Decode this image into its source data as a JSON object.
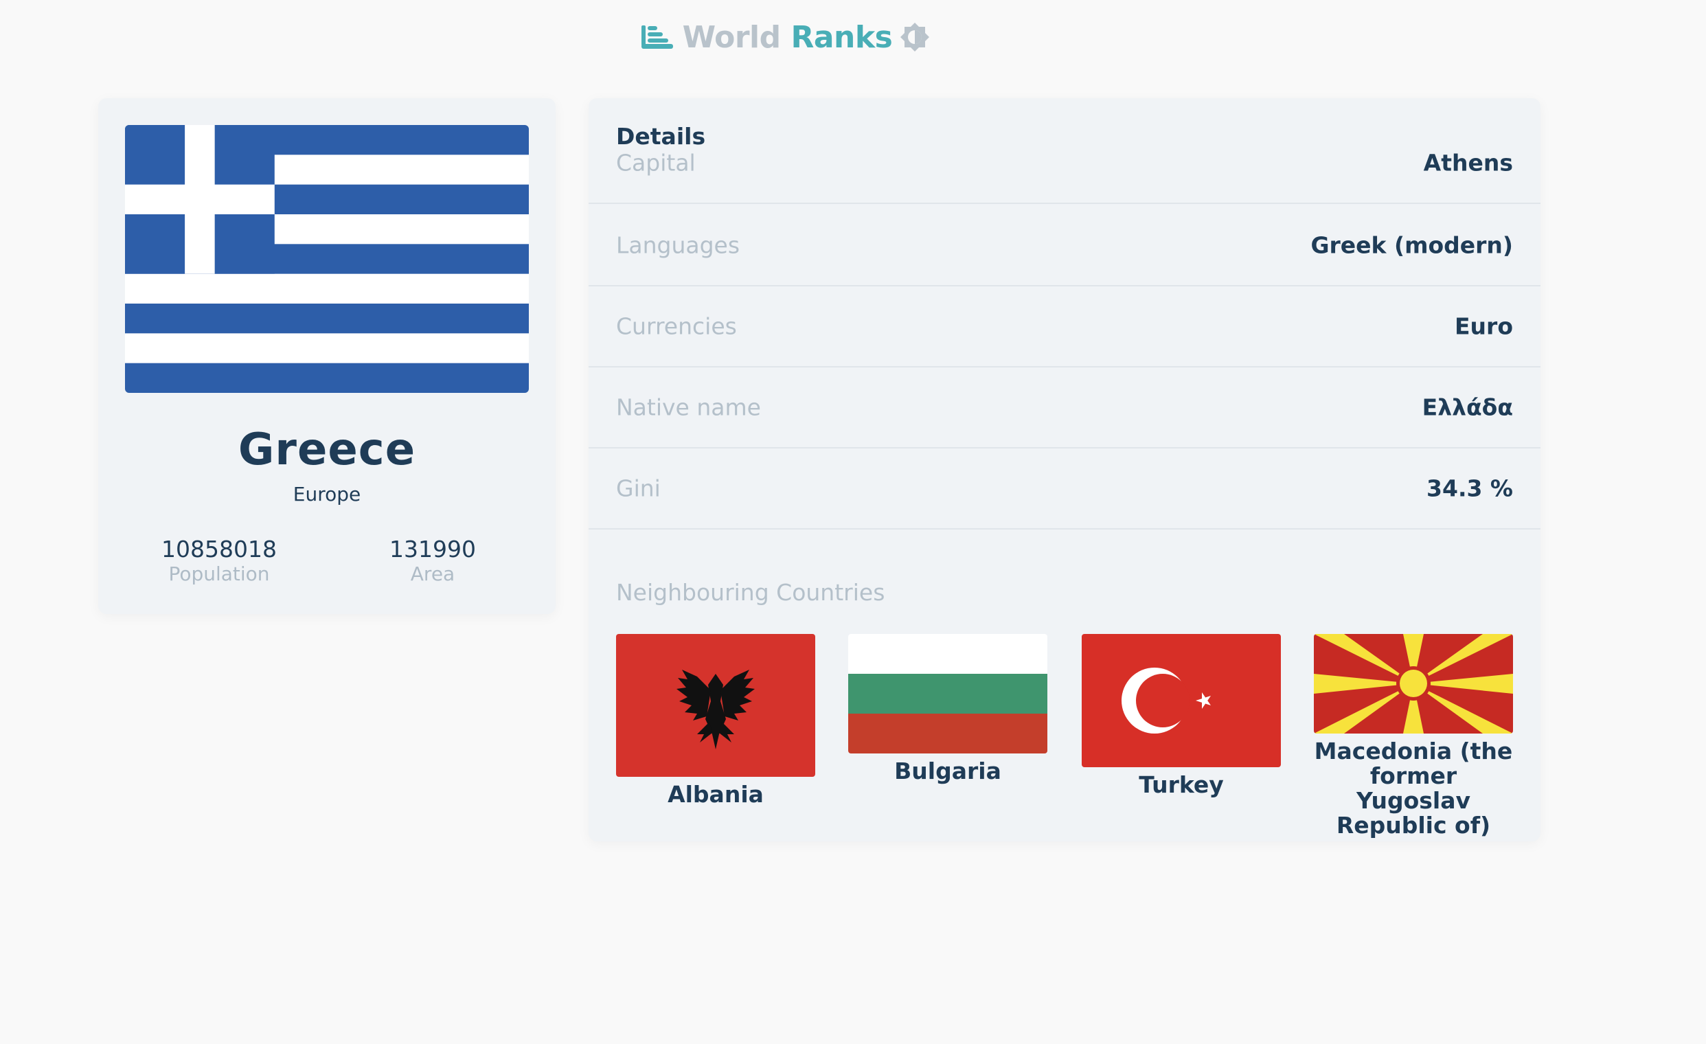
{
  "header": {
    "title_part1": "World",
    "title_part2": "Ranks",
    "logo_icon": "bars-chart-icon",
    "theme_icon": "brightness-icon",
    "colors": {
      "world": "#b9c3cb",
      "ranks": "#49aeb6"
    }
  },
  "country": {
    "name": "Greece",
    "region": "Europe",
    "population_value": "10858018",
    "population_label": "Population",
    "area_value": "131990",
    "area_label": "Area",
    "flag_colors": {
      "blue": "#2d5ea9",
      "white": "#ffffff"
    }
  },
  "details": {
    "title": "Details",
    "rows": [
      {
        "label": "Capital",
        "value": "Athens"
      },
      {
        "label": "Languages",
        "value": "Greek (modern)"
      },
      {
        "label": "Currencies",
        "value": "Euro"
      },
      {
        "label": "Native name",
        "value": "Ελλάδα"
      },
      {
        "label": "Gini",
        "value": "34.3 %"
      }
    ],
    "neighbours_title": "Neighbouring Countries",
    "neighbours": [
      {
        "name": "Albania"
      },
      {
        "name": "Bulgaria"
      },
      {
        "name": "Turkey"
      },
      {
        "name": "Macedonia (the former Yugoslav Republic of)"
      }
    ]
  }
}
